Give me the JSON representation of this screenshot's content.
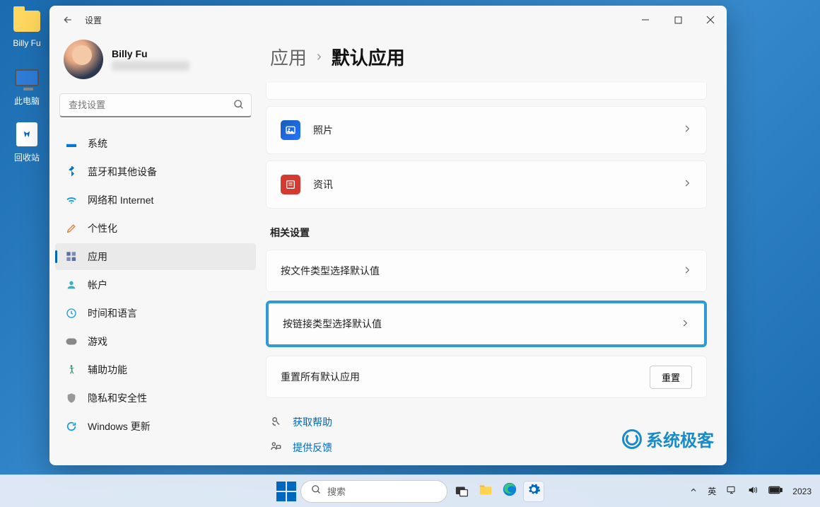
{
  "desktop": {
    "icons": [
      {
        "name": "folder",
        "label": "Billy Fu"
      },
      {
        "name": "pc",
        "label": "此电脑"
      },
      {
        "name": "bin",
        "label": "回收站"
      }
    ]
  },
  "window": {
    "title": "设置",
    "back_aria": "返回"
  },
  "profile": {
    "name": "Billy Fu"
  },
  "search": {
    "placeholder": "查找设置"
  },
  "nav": [
    {
      "key": "system",
      "label": "系统",
      "icon": "monitor",
      "color": "#0078d4"
    },
    {
      "key": "bluetooth",
      "label": "蓝牙和其他设备",
      "icon": "bluetooth",
      "color": "#0078d4"
    },
    {
      "key": "network",
      "label": "网络和 Internet",
      "icon": "wifi",
      "color": "#0a9cf0"
    },
    {
      "key": "personalization",
      "label": "个性化",
      "icon": "brush",
      "color": "#e8762e"
    },
    {
      "key": "apps",
      "label": "应用",
      "icon": "apps",
      "color": "#5b6fa1",
      "active": true
    },
    {
      "key": "accounts",
      "label": "帐户",
      "icon": "person",
      "color": "#3aaec2"
    },
    {
      "key": "time",
      "label": "时间和语言",
      "icon": "globe",
      "color": "#1a9cd8"
    },
    {
      "key": "gaming",
      "label": "游戏",
      "icon": "gamepad",
      "color": "#888"
    },
    {
      "key": "accessibility",
      "label": "辅助功能",
      "icon": "accessibility",
      "color": "#1a8b5e"
    },
    {
      "key": "privacy",
      "label": "隐私和安全性",
      "icon": "shield",
      "color": "#888"
    },
    {
      "key": "update",
      "label": "Windows 更新",
      "icon": "update",
      "color": "#0a9cf0"
    }
  ],
  "breadcrumb": {
    "parent": "应用",
    "separator": "›",
    "current": "默认应用"
  },
  "app_cards": [
    {
      "key": "photos",
      "label": "照片"
    },
    {
      "key": "news",
      "label": "资讯"
    }
  ],
  "related_section_title": "相关设置",
  "related_rows": [
    {
      "key": "by_filetype",
      "label": "按文件类型选择默认值"
    },
    {
      "key": "by_linktype",
      "label": "按链接类型选择默认值",
      "highlighted": true
    },
    {
      "key": "reset_all",
      "label": "重置所有默认应用",
      "button": "重置"
    }
  ],
  "links": [
    {
      "key": "help",
      "label": "获取帮助",
      "icon": "help"
    },
    {
      "key": "feedback",
      "label": "提供反馈",
      "icon": "feedback"
    }
  ],
  "watermark": "系统极客",
  "taskbar": {
    "search_placeholder": "搜索",
    "ime": "英",
    "year": "2023"
  }
}
